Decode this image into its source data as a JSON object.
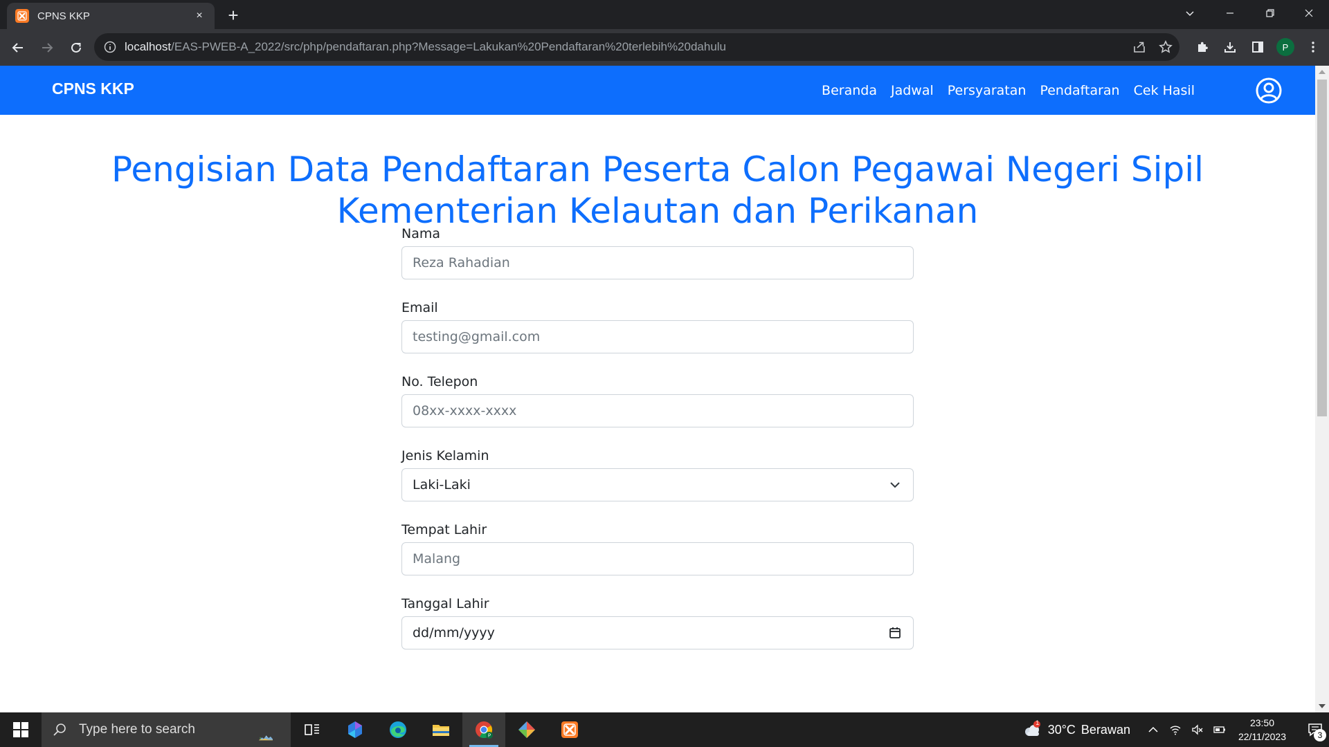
{
  "browser": {
    "tab_title": "CPNS KKP",
    "tab_close": "×",
    "new_tab": "+",
    "url_host": "localhost",
    "url_path": "/EAS-PWEB-A_2022/src/php/pendaftaran.php?Message=Lakukan%20Pendaftaran%20terlebih%20dahulu",
    "profile_initial": "P"
  },
  "site": {
    "brand": "CPNS KKP",
    "nav": [
      "Beranda",
      "Jadwal",
      "Persyaratan",
      "Pendaftaran",
      "Cek Hasil"
    ],
    "heading_line1": "Pengisian Data Pendaftaran Peserta Calon Pegawai Negeri Sipil",
    "heading_line2": "Kementerian Kelautan dan Perikanan",
    "accent_color": "#0d6efd"
  },
  "form": {
    "nama": {
      "label": "Nama",
      "placeholder": "Reza Rahadian"
    },
    "email": {
      "label": "Email",
      "placeholder": "testing@gmail.com"
    },
    "telepon": {
      "label": "No. Telepon",
      "placeholder": "08xx-xxxx-xxxx"
    },
    "jenis_kelamin": {
      "label": "Jenis Kelamin",
      "value": "Laki-Laki"
    },
    "tempat_lahir": {
      "label": "Tempat Lahir",
      "placeholder": "Malang"
    },
    "tanggal_lahir": {
      "label": "Tanggal Lahir",
      "value": "dd/mm/yyyy"
    }
  },
  "taskbar": {
    "search_placeholder": "Type here to search",
    "weather_temp": "30°C",
    "weather_desc": "Berawan",
    "weather_badge": "1",
    "time": "23:50",
    "date": "22/11/2023",
    "notif_count": "3"
  }
}
